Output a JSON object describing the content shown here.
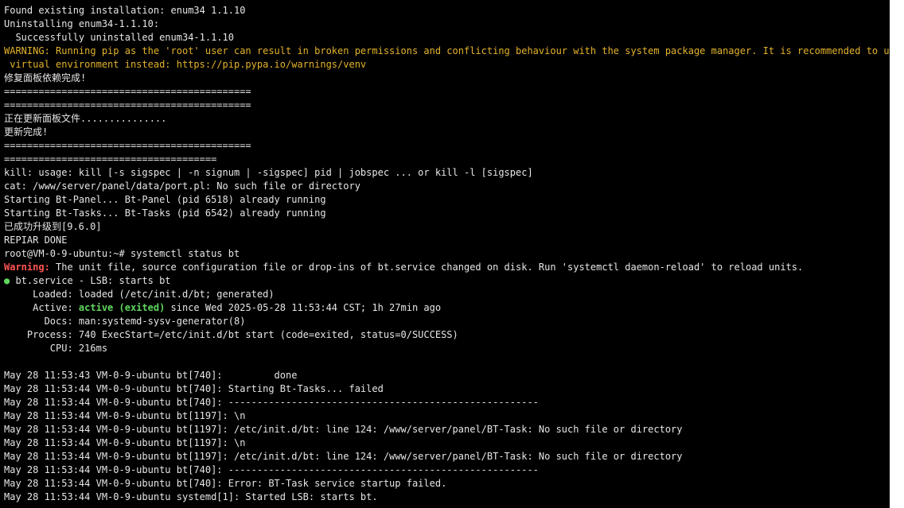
{
  "colors": {
    "background": "#000000",
    "text": "#e6e6e6",
    "warning": "#e3b22b",
    "error_label": "#ff5555",
    "active": "#5fd75f"
  },
  "lines": [
    "Found existing installation: enum34 1.1.10",
    "Uninstalling enum34-1.1.10:",
    "  Successfully uninstalled enum34-1.1.10",
    "WARNING: Running pip as the 'root' user can result in broken permissions and conflicting behaviour with the system package manager. It is recommended to use a",
    " virtual environment instead: https://pip.pypa.io/warnings/venv",
    "修复面板依赖完成!",
    "===========================================",
    "===========================================",
    "正在更新面板文件...............",
    "更新完成!",
    "===========================================",
    "=====================================",
    "kill: usage: kill [-s sigspec | -n signum | -sigspec] pid | jobspec ... or kill -l [sigspec]",
    "cat: /www/server/panel/data/port.pl: No such file or directory",
    "Starting Bt-Panel... Bt-Panel (pid 6518) already running",
    "Starting Bt-Tasks... Bt-Tasks (pid 6542) already running",
    "已成功升级到[9.6.0]",
    "REPIAR DONE",
    "root@VM-0-9-ubuntu:~# systemctl status bt"
  ],
  "warning_line": {
    "label": "Warning:",
    "text": " The unit file, source configuration file or drop-ins of bt.service changed on disk. Run 'systemctl daemon-reload' to reload units."
  },
  "service": {
    "bullet": "●",
    "title": " bt.service - LSB: starts bt",
    "loaded": "     Loaded: loaded (/etc/init.d/bt; generated)",
    "active_prefix": "     Active: ",
    "active_state": "active (exited)",
    "active_suffix": " since Wed 2025-05-28 11:53:44 CST; 1h 27min ago",
    "docs": "       Docs: man:systemd-sysv-generator(8)",
    "process": "    Process: 740 ExecStart=/etc/init.d/bt start (code=exited, status=0/SUCCESS)",
    "cpu": "        CPU: 216ms"
  },
  "log": [
    "May 28 11:53:43 VM-0-9-ubuntu bt[740]:         done",
    "May 28 11:53:44 VM-0-9-ubuntu bt[740]: Starting Bt-Tasks... failed",
    "May 28 11:53:44 VM-0-9-ubuntu bt[740]: ------------------------------------------------------",
    "May 28 11:53:44 VM-0-9-ubuntu bt[1197]: \\n",
    "May 28 11:53:44 VM-0-9-ubuntu bt[1197]: /etc/init.d/bt: line 124: /www/server/panel/BT-Task: No such file or directory",
    "May 28 11:53:44 VM-0-9-ubuntu bt[1197]: \\n",
    "May 28 11:53:44 VM-0-9-ubuntu bt[1197]: /etc/init.d/bt: line 124: /www/server/panel/BT-Task: No such file or directory",
    "May 28 11:53:44 VM-0-9-ubuntu bt[740]: ------------------------------------------------------",
    "May 28 11:53:44 VM-0-9-ubuntu bt[740]: Error: BT-Task service startup failed.",
    "May 28 11:53:44 VM-0-9-ubuntu systemd[1]: Started LSB: starts bt."
  ]
}
